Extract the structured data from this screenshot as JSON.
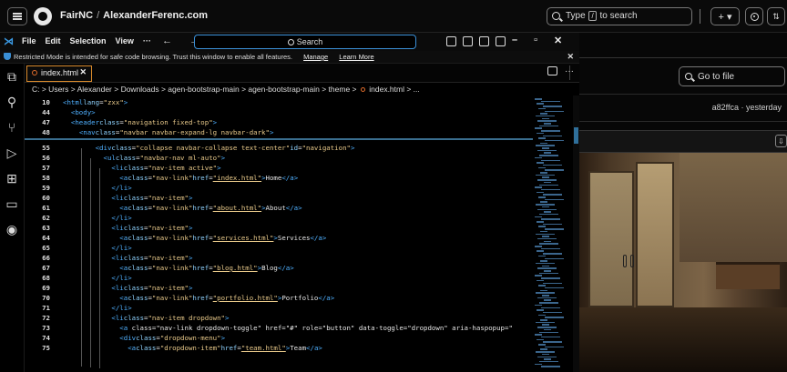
{
  "github": {
    "org": "FairNC",
    "repo": "AlexanderFerenc.com",
    "search_prefix": "Type",
    "search_key": "/",
    "search_suffix": "to search",
    "plus_label": "+ ▾",
    "goto_file": "Go to file",
    "commit_info": "a82ffca · yesterday",
    "download_icon": "⇩"
  },
  "vscode": {
    "menu": [
      "File",
      "Edit",
      "Selection",
      "View",
      "···"
    ],
    "nav": "← →",
    "command_center": "Search",
    "restricted_message": "Restricted Mode is intended for safe code browsing. Trust this window to enable all features.",
    "manage_link": "Manage",
    "learn_more_link": "Learn More",
    "tab_label": "index.html",
    "breadcrumb_path": "C: > Users > Alexander > Downloads > agen-bootstrap-main > agen-bootstrap-main > theme >",
    "breadcrumb_file": "index.html > ...",
    "colors": {
      "accent": "#3a8fd6",
      "tab_border": "#d98a2b",
      "tag": "#4fb0ff",
      "string": "#e8c98a"
    }
  },
  "code": {
    "sticky": [
      {
        "n": "10",
        "text": "<html lang=\"zxx\">"
      },
      {
        "n": "44",
        "text": "  <body>"
      },
      {
        "n": "47",
        "text": "  <header class=\"navigation fixed-top\">"
      },
      {
        "n": "48",
        "text": "    <nav class=\"navbar navbar-expand-lg navbar-dark\">"
      }
    ],
    "lines": [
      {
        "n": "55",
        "text": "        <div class=\"collapse navbar-collapse text-center\" id=\"navigation\">"
      },
      {
        "n": "56",
        "text": "          <ul class=\"navbar-nav ml-auto\">"
      },
      {
        "n": "57",
        "text": "            <li class=\"nav-item active\">"
      },
      {
        "n": "58",
        "text": "              <a class=\"nav-link\" href=\"index.html\">Home</a>"
      },
      {
        "n": "59",
        "text": "            </li>"
      },
      {
        "n": "60",
        "text": "            <li class=\"nav-item\">"
      },
      {
        "n": "61",
        "text": "              <a class=\"nav-link\" href=\"about.html\">About</a>"
      },
      {
        "n": "62",
        "text": "            </li>"
      },
      {
        "n": "63",
        "text": "            <li class=\"nav-item\">"
      },
      {
        "n": "64",
        "text": "              <a class=\"nav-link\" href=\"services.html\">Services</a>"
      },
      {
        "n": "65",
        "text": "            </li>"
      },
      {
        "n": "66",
        "text": "            <li class=\"nav-item\">"
      },
      {
        "n": "67",
        "text": "              <a class=\"nav-link\" href=\"blog.html\">Blog</a>"
      },
      {
        "n": "68",
        "text": "            </li>"
      },
      {
        "n": "69",
        "text": "            <li class=\"nav-item\">"
      },
      {
        "n": "70",
        "text": "              <a class=\"nav-link\" href=\"portfolio.html\">Portfolio</a>"
      },
      {
        "n": "71",
        "text": "            </li>"
      },
      {
        "n": "72",
        "text": "            <li class=\"nav-item dropdown\">"
      },
      {
        "n": "73",
        "text": "              <a class=\"nav-link dropdown-toggle\" href=\"#\" role=\"button\" data-toggle=\"dropdown\" aria-haspopup=\""
      },
      {
        "n": "74",
        "text": "              <div class=\"dropdown-menu\">"
      },
      {
        "n": "75",
        "text": "                <a class=\"dropdown-item\" href=\"team.html\">Team</a>"
      }
    ]
  }
}
